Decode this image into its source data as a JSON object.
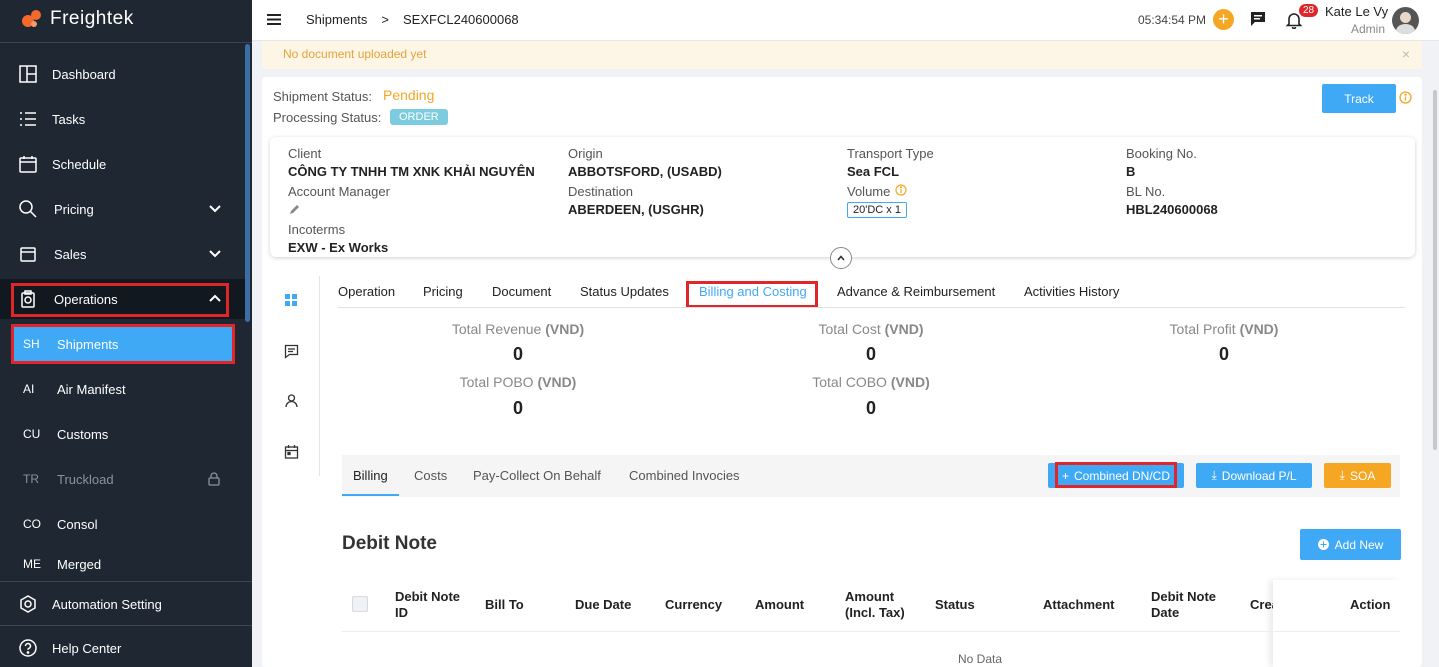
{
  "brand": {
    "name": "Freightek",
    "accent": "#f26a2c"
  },
  "sidebar": {
    "items": [
      {
        "label": "Dashboard",
        "icon": "dashboard-icon"
      },
      {
        "label": "Tasks",
        "icon": "tasks-icon"
      },
      {
        "label": "Schedule",
        "icon": "calendar-icon"
      },
      {
        "label": "Pricing",
        "icon": "pricing-icon"
      },
      {
        "label": "Sales",
        "icon": "sales-icon"
      },
      {
        "label": "Operations",
        "icon": "operations-icon"
      }
    ],
    "sub_items": [
      {
        "abbr": "SH",
        "label": "Shipments"
      },
      {
        "abbr": "AI",
        "label": "Air Manifest"
      },
      {
        "abbr": "CU",
        "label": "Customs"
      },
      {
        "abbr": "TR",
        "label": "Truckload"
      },
      {
        "abbr": "CO",
        "label": "Consol"
      },
      {
        "abbr": "ME",
        "label": "Merged"
      }
    ],
    "bottom": [
      {
        "label": "Automation Setting",
        "icon": "gear-icon"
      },
      {
        "label": "Help Center",
        "icon": "help-icon"
      }
    ]
  },
  "header": {
    "breadcrumb": [
      "Shipments",
      ">",
      "SEXFCL240600068"
    ],
    "time": "05:34:54 PM",
    "notification_count": "28",
    "user_name": "Kate Le Vy",
    "user_role": "Admin"
  },
  "notice": {
    "text": "No document uploaded yet",
    "close": "×"
  },
  "status": {
    "shipment_label": "Shipment Status:",
    "shipment_value": "Pending",
    "processing_label": "Processing Status:",
    "processing_value": "ORDER",
    "track_label": "Track"
  },
  "info": {
    "client_label": "Client",
    "client_value": "CÔNG TY TNHH TM XNK KHẢI NGUYÊN",
    "account_manager_label": "Account Manager",
    "incoterms_label": "Incoterms",
    "incoterms_value": "EXW - Ex Works",
    "origin_label": "Origin",
    "origin_value": "ABBOTSFORD, (USABD)",
    "destination_label": "Destination",
    "destination_value": "ABERDEEN, (USGHR)",
    "transport_label": "Transport Type",
    "transport_value": "Sea FCL",
    "volume_label": "Volume",
    "volume_value": "20'DC x 1",
    "booking_label": "Booking No.",
    "booking_value": "B",
    "bl_label": "BL No.",
    "bl_value": "HBL240600068"
  },
  "tabs": [
    "Operation",
    "Pricing",
    "Document",
    "Status Updates",
    "Billing and Costing",
    "Advance & Reimbursement",
    "Activities History"
  ],
  "summary": {
    "revenue_label": "Total Revenue",
    "revenue_value": "0",
    "cost_label": "Total Cost",
    "cost_value": "0",
    "profit_label": "Total Profit",
    "profit_value": "0",
    "pobo_label": "Total POBO",
    "pobo_value": "0",
    "cobo_label": "Total COBO",
    "cobo_value": "0",
    "currency": "(VND)"
  },
  "subtabs": [
    "Billing",
    "Costs",
    "Pay-Collect On Behalf",
    "Combined Invocies"
  ],
  "actions": {
    "combined": "Combined DN/CD",
    "download": "Download P/L",
    "soa": "SOA"
  },
  "debit": {
    "title": "Debit Note",
    "add_new": "Add New",
    "columns": [
      "Debit Note ID",
      "Bill To",
      "Due Date",
      "Currency",
      "Amount",
      "Amount (Incl. Tax)",
      "Status",
      "Attachment",
      "Debit Note Date",
      "Crea",
      "Action"
    ],
    "empty": "No Data"
  },
  "colors": {
    "sidebar": "#1f2733",
    "active": "#3fa9f5",
    "orange": "#f5a623",
    "red": "#e0262b"
  }
}
